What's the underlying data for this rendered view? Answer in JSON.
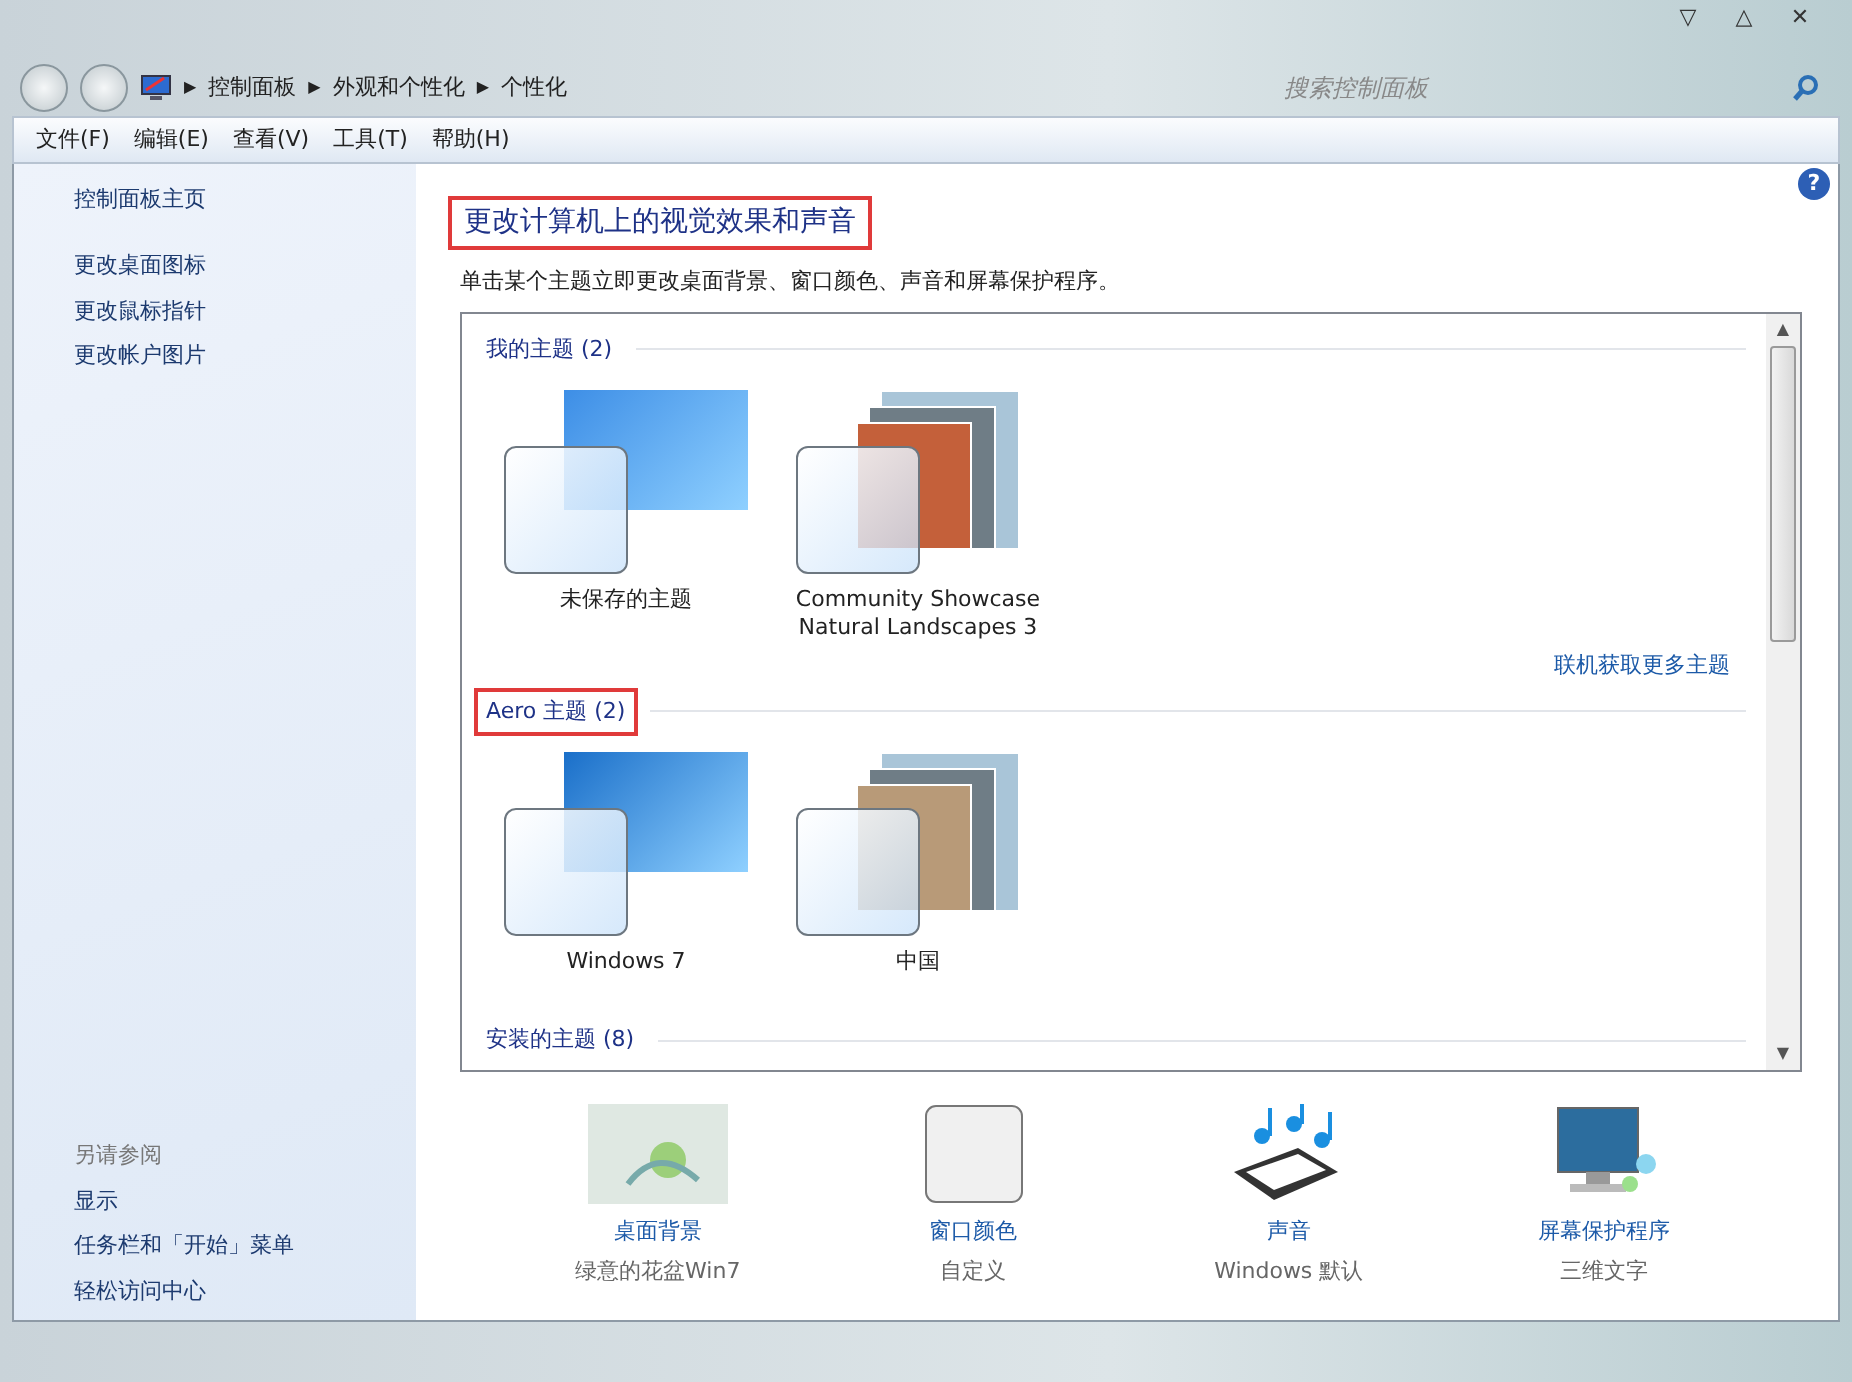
{
  "window": {
    "buttons": [
      "▽",
      "△",
      "✕"
    ]
  },
  "address_bar": {
    "separator": "▶",
    "path": [
      "控制面板",
      "外观和个性化",
      "个性化"
    ]
  },
  "help": "?",
  "scrollbar": {
    "up": "▲",
    "down": "▼"
  },
  "search": {
    "placeholder": "搜索控制面板"
  },
  "menu": [
    "文件(F)",
    "编辑(E)",
    "查看(V)",
    "工具(T)",
    "帮助(H)"
  ],
  "sidebar": {
    "home": "控制面板主页",
    "items": [
      "更改桌面图标",
      "更改鼠标指针",
      "更改帐户图片"
    ],
    "see_also_title": "另请参阅",
    "see_also": [
      "显示",
      "任务栏和「开始」菜单",
      "轻松访问中心"
    ]
  },
  "heading": {
    "text": "更改计算机上的视觉效果和声音",
    "highlighted": true
  },
  "description": "单击某个主题立即更改桌面背景、窗口颜色、声音和屏幕保护程序。",
  "theme_groups": [
    {
      "title": "我的主题 (2)",
      "highlighted": false,
      "link": "联机获取更多主题",
      "themes": [
        {
          "name": "未保存的主题",
          "kind": "single",
          "color": "#3d8ee6"
        },
        {
          "name": "Community Showcase\nNatural Landscapes 3",
          "kind": "stack",
          "color": "#c4603a"
        }
      ]
    },
    {
      "title": "Aero 主题 (2)",
      "highlighted": true,
      "themes": [
        {
          "name": "Windows 7",
          "kind": "single",
          "color": "#1a6fc9"
        },
        {
          "name": "中国",
          "kind": "stack",
          "color": "#b89a78"
        }
      ]
    },
    {
      "title": "安装的主题 (8)",
      "highlighted": false
    }
  ],
  "settings": [
    {
      "kind": "background",
      "label": "桌面背景",
      "value": "绿意的花盆Win7"
    },
    {
      "kind": "color",
      "label": "窗口颜色",
      "value": "自定义"
    },
    {
      "kind": "sound",
      "label": "声音",
      "value": "Windows 默认"
    },
    {
      "kind": "screensaver",
      "label": "屏幕保护程序",
      "value": "三维文字"
    }
  ]
}
